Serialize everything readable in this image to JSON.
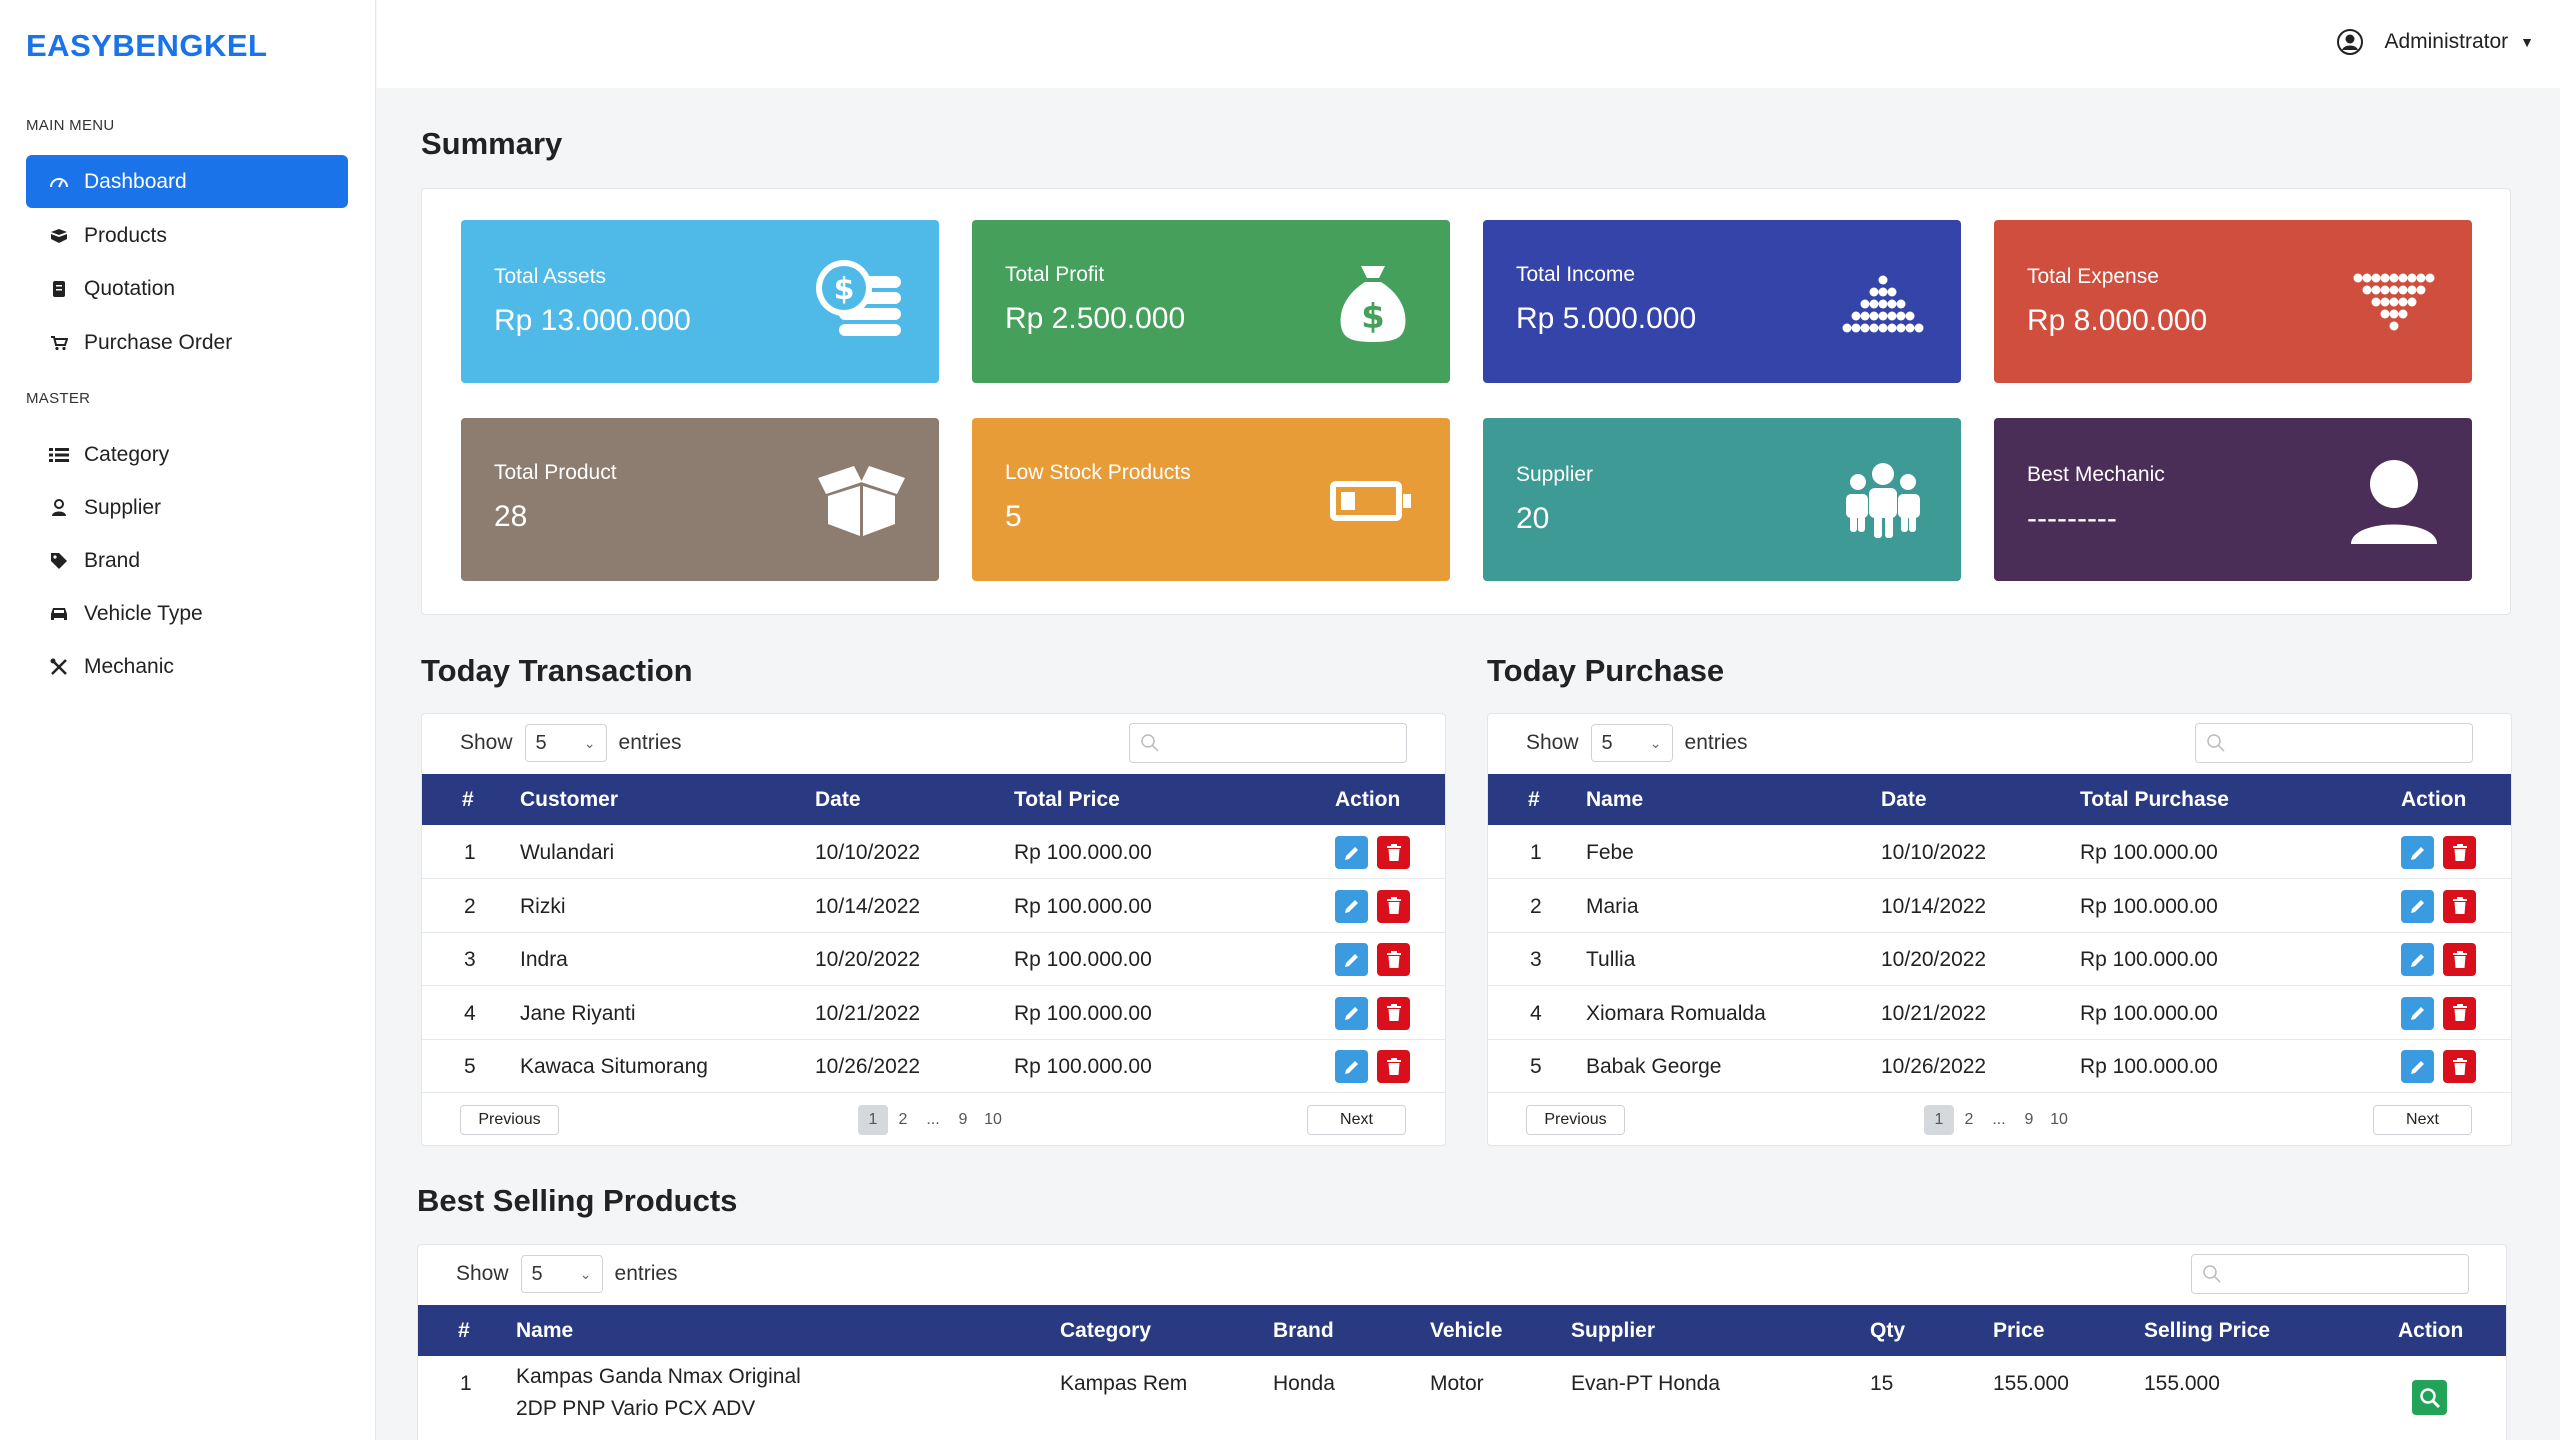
{
  "app": {
    "brand": "EASYBENGKEL"
  },
  "sidebar": {
    "main_menu_label": "MAIN MENU",
    "master_label": "MASTER",
    "main_items": [
      {
        "label": "Dashboard",
        "icon": "gauge-icon",
        "active": true
      },
      {
        "label": "Products",
        "icon": "boxes-icon"
      },
      {
        "label": "Quotation",
        "icon": "document-icon"
      },
      {
        "label": "Purchase Order",
        "icon": "cart-icon"
      }
    ],
    "master_items": [
      {
        "label": "Category",
        "icon": "list-icon"
      },
      {
        "label": "Supplier",
        "icon": "user-tie-icon"
      },
      {
        "label": "Brand",
        "icon": "tag-icon"
      },
      {
        "label": "Vehicle Type",
        "icon": "car-icon"
      },
      {
        "label": "Mechanic",
        "icon": "tools-icon"
      }
    ]
  },
  "topbar": {
    "user_label": "Administrator"
  },
  "summary": {
    "title": "Summary",
    "cards": [
      {
        "title": "Total Assets",
        "value": "Rp 13.000.000",
        "color": "#4fb9e8",
        "icon": "coins-icon"
      },
      {
        "title": "Total Profit",
        "value": "Rp 2.500.000",
        "color": "#45a05c",
        "icon": "money-bag-icon"
      },
      {
        "title": "Total Income",
        "value": "Rp 5.000.000",
        "color": "#3544a8",
        "icon": "dots-up-icon"
      },
      {
        "title": "Total Expense",
        "value": "Rp 8.000.000",
        "color": "#cf4e3e",
        "icon": "dots-down-icon"
      },
      {
        "title": "Total Product",
        "value": "28",
        "color": "#8d7d70",
        "icon": "open-box-icon"
      },
      {
        "title": "Low Stock Products",
        "value": "5",
        "color": "#e89c38",
        "icon": "battery-low-icon"
      },
      {
        "title": "Supplier",
        "value": "20",
        "color": "#3e9a95",
        "icon": "group-icon"
      },
      {
        "title": "Best Mechanic",
        "value": "---------",
        "color": "#4b2e57",
        "icon": "person-icon"
      }
    ]
  },
  "today_transaction": {
    "title": "Today Transaction",
    "show_label": "Show",
    "entries_value": "5",
    "entries_label": "entries",
    "columns": [
      "#",
      "Customer",
      "Date",
      "Total Price",
      "Action"
    ],
    "rows": [
      [
        "1",
        "Wulandari",
        "10/10/2022",
        "Rp 100.000.00"
      ],
      [
        "2",
        "Rizki",
        "10/14/2022",
        "Rp 100.000.00"
      ],
      [
        "3",
        "Indra",
        "10/20/2022",
        "Rp 100.000.00"
      ],
      [
        "4",
        "Jane Riyanti",
        "10/21/2022",
        "Rp 100.000.00"
      ],
      [
        "5",
        "Kawaca Situmorang",
        "10/26/2022",
        "Rp 100.000.00"
      ]
    ],
    "pagination": {
      "previous": "Previous",
      "next": "Next",
      "pages": [
        "1",
        "2",
        "...",
        "9",
        "10"
      ],
      "current": "1"
    }
  },
  "today_purchase": {
    "title": "Today Purchase",
    "show_label": "Show",
    "entries_value": "5",
    "entries_label": "entries",
    "columns": [
      "#",
      "Name",
      "Date",
      "Total Purchase",
      "Action"
    ],
    "rows": [
      [
        "1",
        "Febe",
        "10/10/2022",
        "Rp 100.000.00"
      ],
      [
        "2",
        "Maria",
        "10/14/2022",
        "Rp 100.000.00"
      ],
      [
        "3",
        "Tullia",
        "10/20/2022",
        "Rp 100.000.00"
      ],
      [
        "4",
        "Xiomara Romualda",
        "10/21/2022",
        "Rp 100.000.00"
      ],
      [
        "5",
        "Babak George",
        "10/26/2022",
        "Rp 100.000.00"
      ]
    ],
    "pagination": {
      "previous": "Previous",
      "next": "Next",
      "pages": [
        "1",
        "2",
        "...",
        "9",
        "10"
      ],
      "current": "1"
    }
  },
  "best_selling": {
    "title": "Best Selling Products",
    "show_label": "Show",
    "entries_value": "5",
    "entries_label": "entries",
    "columns": [
      "#",
      "Name",
      "Category",
      "Brand",
      "Vehicle",
      "Supplier",
      "Qty",
      "Price",
      "Selling Price",
      "Action"
    ],
    "rows": [
      {
        "no": "1",
        "name_line1": "Kampas Ganda Nmax Original",
        "name_line2": "2DP PNP Vario PCX ADV",
        "category": "Kampas Rem",
        "brand": "Honda",
        "vehicle": "Motor",
        "supplier": "Evan-PT Honda",
        "qty": "15",
        "price": "155.000",
        "selling_price": "155.000"
      }
    ]
  }
}
